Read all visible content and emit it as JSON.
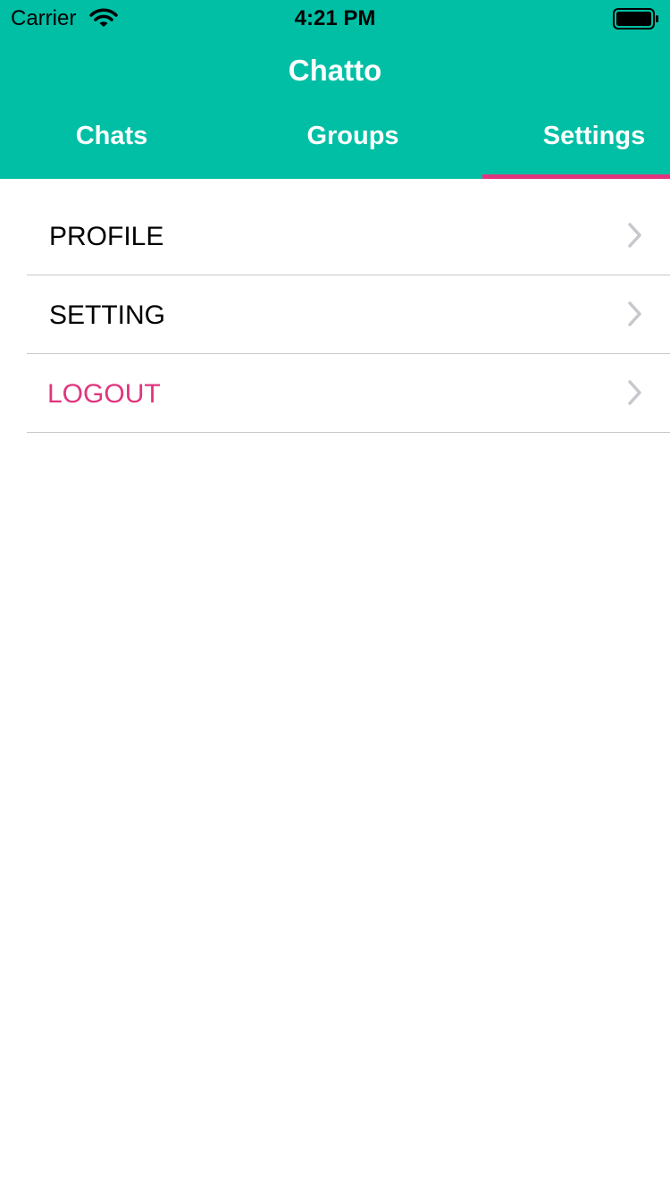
{
  "status_bar": {
    "carrier": "Carrier",
    "time": "4:21 PM",
    "wifi_icon": "wifi-icon",
    "battery_icon": "battery-icon"
  },
  "nav": {
    "title": "Chatto"
  },
  "tabs": [
    {
      "label": "Chats",
      "selected": false
    },
    {
      "label": "Groups",
      "selected": false
    },
    {
      "label": "Settings",
      "selected": true
    }
  ],
  "menu": [
    {
      "label": "PROFILE",
      "icon": "chevron-right-icon"
    },
    {
      "label": "SETTING",
      "icon": "chevron-right-icon"
    },
    {
      "label": "LOGOUT",
      "icon": "chevron-right-icon"
    }
  ],
  "colors": {
    "header": "#00BFA5",
    "accent": "#E0357E",
    "separator": "#C8C8C8",
    "chevron": "#C7C7CC"
  }
}
